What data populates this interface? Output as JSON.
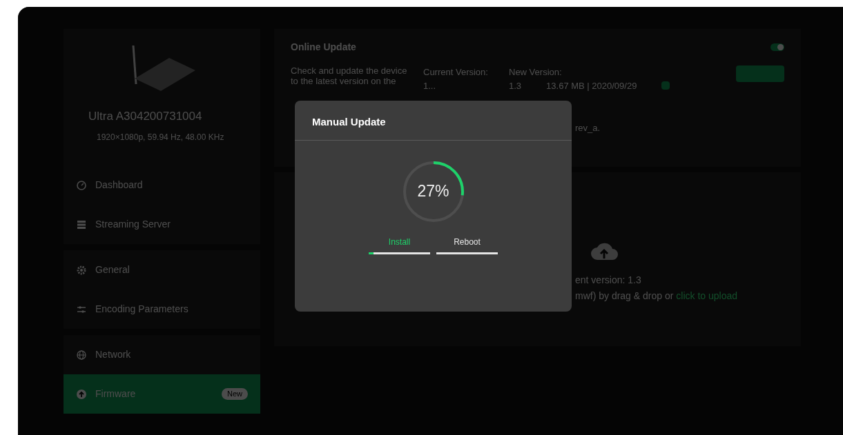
{
  "device": {
    "name": "Ultra A304200731004",
    "signal": "1920×1080p, 59.94 Hz, 48.00 KHz"
  },
  "sidebar": {
    "items": [
      {
        "label": "Dashboard",
        "selected": false
      },
      {
        "label": "Streaming Server",
        "selected": false
      },
      {
        "label": "General",
        "selected": false
      },
      {
        "label": "Encoding Parameters",
        "selected": false
      },
      {
        "label": "Network",
        "selected": false
      },
      {
        "label": "Firmware",
        "selected": true,
        "badge": "New"
      }
    ]
  },
  "online_update": {
    "title": "Online Update",
    "on": true,
    "description": [
      "Check and update the device",
      "to the latest version on the"
    ],
    "current_label": "Current Version:",
    "current_value": "1...",
    "new_label": "New Version:",
    "new_value": "1.3",
    "new_info": "13.67 MB | 2020/09/29",
    "note": "rev_a."
  },
  "manual_panel": {
    "current_version": "ent version: 1.3",
    "hint": "mwf) by drag & drop or",
    "link": "click to upload"
  },
  "dialog": {
    "title": "Manual Update",
    "progress": {
      "level": 0.27,
      "reading": "27%"
    },
    "steps": [
      {
        "label": "Install",
        "selected": true,
        "level": 0.08
      },
      {
        "label": "Reboot",
        "selected": false,
        "level": 0
      }
    ]
  }
}
